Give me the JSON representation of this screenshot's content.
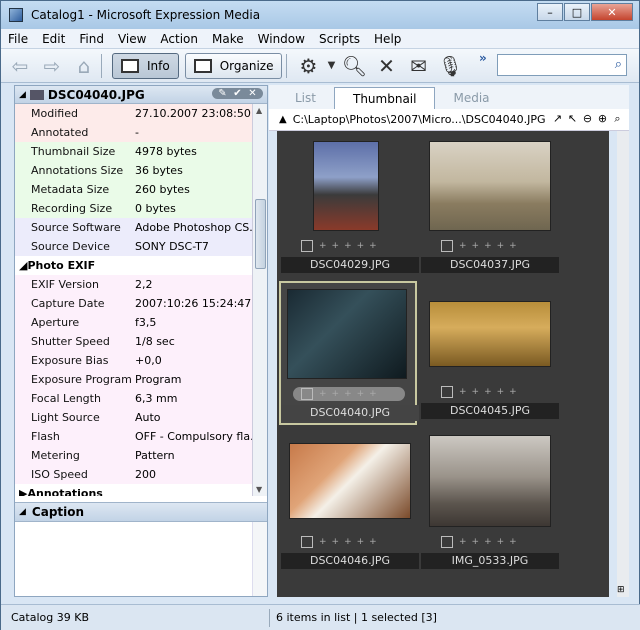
{
  "window": {
    "title": "Catalog1 - Microsoft Expression Media"
  },
  "menu": [
    "File",
    "Edit",
    "Find",
    "View",
    "Action",
    "Make",
    "Window",
    "Scripts",
    "Help"
  ],
  "toolbar": {
    "info_label": "Info",
    "organize_label": "Organize",
    "search_placeholder": ""
  },
  "info_panel": {
    "filename": "DSC04040.JPG",
    "rows_top": [
      {
        "k": "Modified",
        "v": "27.10.2007 23:08:50",
        "bg": "#fdebea"
      },
      {
        "k": "Annotated",
        "v": "-",
        "bg": "#fdebea"
      },
      {
        "k": "Thumbnail Size",
        "v": "4978 bytes",
        "bg": "#eafbe8"
      },
      {
        "k": "Annotations Size",
        "v": "36 bytes",
        "bg": "#eafbe8"
      },
      {
        "k": "Metadata Size",
        "v": "260 bytes",
        "bg": "#eafbe8"
      },
      {
        "k": "Recording Size",
        "v": "0 bytes",
        "bg": "#eafbe8"
      },
      {
        "k": "Source Software",
        "v": "Adobe Photoshop CS...",
        "bg": "#ececfb"
      },
      {
        "k": "Source Device",
        "v": "SONY DSC-T7",
        "bg": "#ececfb"
      }
    ],
    "section_exif": "Photo EXIF",
    "rows_exif": [
      {
        "k": "EXIF Version",
        "v": "2,2"
      },
      {
        "k": "Capture Date",
        "v": "2007:10:26 15:24:47"
      },
      {
        "k": "Aperture",
        "v": "f3,5"
      },
      {
        "k": "Shutter Speed",
        "v": "1/8 sec"
      },
      {
        "k": "Exposure Bias",
        "v": "+0,0"
      },
      {
        "k": "Exposure Program",
        "v": "Program"
      },
      {
        "k": "Focal Length",
        "v": "6,3 mm"
      },
      {
        "k": "Light Source",
        "v": "Auto"
      },
      {
        "k": "Flash",
        "v": "OFF - Compulsory fla..."
      },
      {
        "k": "Metering",
        "v": "Pattern"
      },
      {
        "k": "ISO Speed",
        "v": "200"
      }
    ],
    "section_annotations": "Annotations",
    "caption_label": "Caption"
  },
  "tabs": [
    {
      "label": "List",
      "active": false
    },
    {
      "label": "Thumbnail",
      "active": true
    },
    {
      "label": "Media",
      "active": false
    }
  ],
  "path": "C:\\Laptop\\Photos\\2007\\Micro...\\DSC04040.JPG",
  "thumbnails": [
    {
      "name": "DSC04029.JPG",
      "selected": false
    },
    {
      "name": "DSC04037.JPG",
      "selected": false
    },
    {
      "name": "DSC04040.JPG",
      "selected": true
    },
    {
      "name": "DSC04045.JPG",
      "selected": false
    },
    {
      "name": "DSC04046.JPG",
      "selected": false
    },
    {
      "name": "IMG_0533.JPG",
      "selected": false
    }
  ],
  "status": {
    "catalog": "Catalog  39 KB",
    "items": "6 items in list  |  1 selected [3]"
  }
}
